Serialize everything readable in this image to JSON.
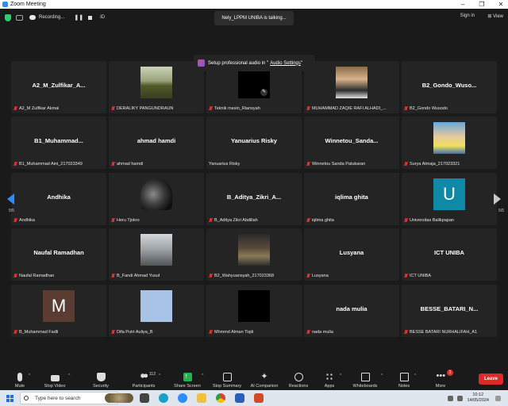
{
  "window": {
    "title": "Zoom Meeting"
  },
  "topbar": {
    "recording_label": "Recording...",
    "pause_symbol": "❚❚",
    "id_label": "ID",
    "talking": "Nely_LPPM UNIBA is talking...",
    "sign_in": "Sign in",
    "view": "View"
  },
  "toast": {
    "text": "Setup professional audio in \"",
    "link": "Audio Settings",
    "end": "\""
  },
  "tiles": [
    {
      "name": "A2_M_Zulfikar_A...",
      "label": "A2_M Zulfikar Akmal",
      "pic": ""
    },
    {
      "name": "",
      "label": "DERALIKY PANGUNDRAUN",
      "pic": "landscape"
    },
    {
      "name": "",
      "label": "Teknik mesin_Riansyah",
      "pic": "black"
    },
    {
      "name": "",
      "label": "MUHAMMAD ZAQIE RAFI ALHADI_...",
      "pic": "person"
    },
    {
      "name": "B2_Gondo_Wuso...",
      "label": "B2_Gondo Wusodo",
      "pic": ""
    },
    {
      "name": "B1_Muhammad...",
      "label": "B1_Muhammad Aini_217023349",
      "pic": ""
    },
    {
      "name": "ahmad hamdi",
      "label": "ahmad hamdi",
      "pic": ""
    },
    {
      "name": "Yanuarius Risky",
      "label": "Yanuarius Risky",
      "pic": "",
      "nomute": true
    },
    {
      "name": "Winnetou_Sanda...",
      "label": "Winnetou Sanda Patukaran",
      "pic": ""
    },
    {
      "name": "",
      "label": "Surya Atmaja_217023321",
      "pic": "boy"
    },
    {
      "name": "Andhika",
      "label": "Andhika",
      "pic": ""
    },
    {
      "name": "",
      "label": "Heru Tjokro",
      "pic": "dark"
    },
    {
      "name": "B_Aditya_Zikri_A...",
      "label": "B_Aditya Zikri Abdillah",
      "pic": ""
    },
    {
      "name": "iqlima ghita",
      "label": "iqlima ghita",
      "pic": ""
    },
    {
      "name": "",
      "label": "Universitas Balikpapan",
      "pic": "u",
      "letter": "U"
    },
    {
      "name": "Naufal Ramadhan",
      "label": "Naufal Ramadhan",
      "pic": ""
    },
    {
      "name": "",
      "label": "B_Fandi Ahmad Yusuf",
      "pic": "road"
    },
    {
      "name": "",
      "label": "B2_Wahyuansyah_217023368",
      "pic": "group"
    },
    {
      "name": "Lusyana",
      "label": "Lusyana",
      "pic": ""
    },
    {
      "name": "ICT UNIBA",
      "label": "ICT UNIBA",
      "pic": ""
    },
    {
      "name": "",
      "label": "B_Muhammad Fadli",
      "pic": "m",
      "letter": "M"
    },
    {
      "name": "",
      "label": "Difa Putri Auliya_B",
      "pic": "blue"
    },
    {
      "name": "",
      "label": "Mhmmd Alman Tiqiii",
      "pic": "black2"
    },
    {
      "name": "nada mulia",
      "label": "nada mulia",
      "pic": ""
    },
    {
      "name": "BESSE_BATARI_N...",
      "label": "BESSE BATARI NURHALIFAH_A1",
      "pic": ""
    }
  ],
  "pager": {
    "left": "5/5",
    "right": "5/5"
  },
  "toolbar": {
    "mute": "Mute",
    "stop_video": "Stop Video",
    "security": "Security",
    "participants": "Participants",
    "participants_count": "112",
    "share_screen": "Share Screen",
    "stop_summary": "Stop Summary",
    "ai_companion": "AI Companion",
    "reactions": "Reactions",
    "apps": "Apps",
    "whiteboards": "Whiteboards",
    "notes": "Notes",
    "more": "More",
    "more_badge": "1",
    "leave": "Leave"
  },
  "taskbar": {
    "search_placeholder": "Type here to search",
    "time": "10:12",
    "date": "14/05/2024"
  }
}
